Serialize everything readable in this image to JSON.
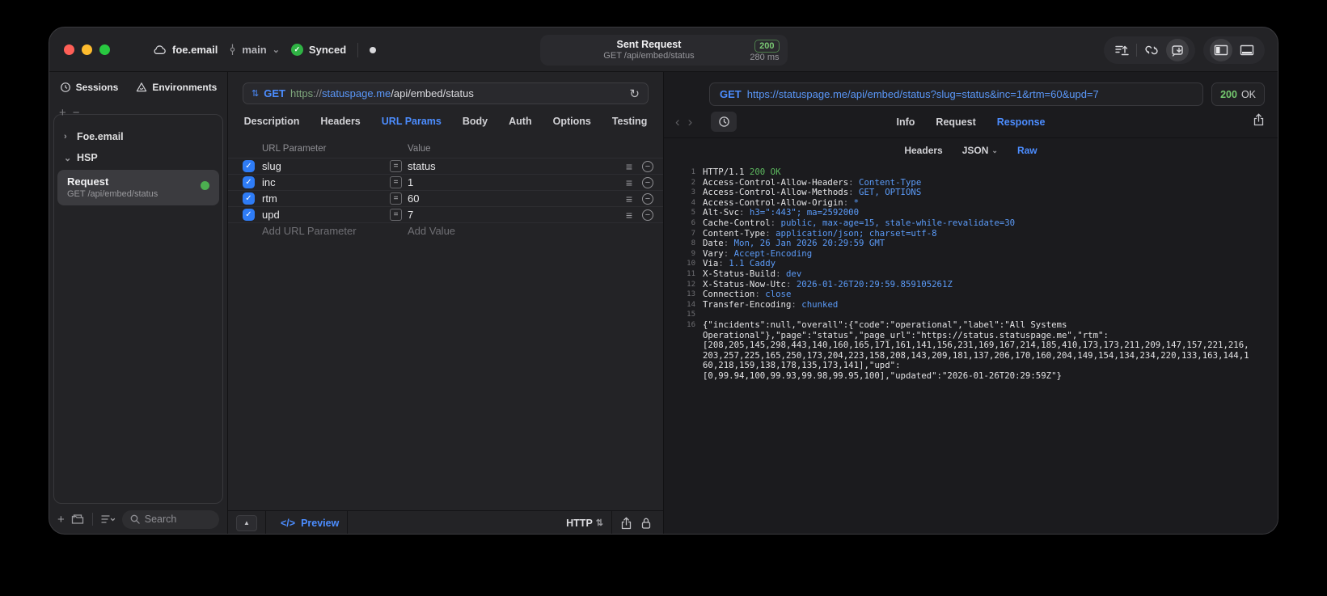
{
  "titlebar": {
    "project": "foe.email",
    "branch": "main",
    "sync_label": "Synced",
    "request_summary": {
      "title": "Sent Request",
      "subtitle": "GET /api/embed/status",
      "status_code": "200",
      "duration": "280 ms"
    }
  },
  "sidebar": {
    "tabs": [
      {
        "label": "Sessions"
      },
      {
        "label": "Environments"
      }
    ],
    "tree": [
      {
        "label": "Foe.email",
        "state": "collapsed"
      },
      {
        "label": "HSP",
        "state": "expanded"
      }
    ],
    "request_item": {
      "title": "Request",
      "subtitle": "GET /api/embed/status"
    },
    "search_placeholder": "Search"
  },
  "request_panel": {
    "method": "GET",
    "url": {
      "scheme": "https",
      "separator": "://",
      "host": "statuspage.me",
      "path": "/api/embed/status"
    },
    "tabs": [
      "Description",
      "Headers",
      "URL Params",
      "Body",
      "Auth",
      "Options",
      "Testing"
    ],
    "active_tab": "URL Params",
    "params": {
      "columns": [
        "URL Parameter",
        "Value"
      ],
      "rows": [
        {
          "name": "slug",
          "value": "status",
          "enabled": true
        },
        {
          "name": "inc",
          "value": "1",
          "enabled": true
        },
        {
          "name": "rtm",
          "value": "60",
          "enabled": true
        },
        {
          "name": "upd",
          "value": "7",
          "enabled": true
        }
      ],
      "add_name_placeholder": "Add URL Parameter",
      "add_value_placeholder": "Add Value"
    },
    "footer": {
      "preview_label": "Preview",
      "protocol": "HTTP"
    }
  },
  "response_panel": {
    "method": "GET",
    "url": "https://statuspage.me/api/embed/status?slug=status&inc=1&rtm=60&upd=7",
    "status_badge": {
      "code": "200",
      "text": "OK"
    },
    "tabs": [
      "Info",
      "Request",
      "Response"
    ],
    "active_tab": "Response",
    "subtabs": [
      {
        "label": "Headers"
      },
      {
        "label": "JSON",
        "dropdown": true
      },
      {
        "label": "Raw"
      }
    ],
    "active_subtab": "Raw",
    "raw": {
      "status_line": {
        "protocol": "HTTP/1.1",
        "status": "200 OK"
      },
      "headers": [
        {
          "key": "Access-Control-Allow-Headers",
          "value": "Content-Type"
        },
        {
          "key": "Access-Control-Allow-Methods",
          "value": "GET, OPTIONS"
        },
        {
          "key": "Access-Control-Allow-Origin",
          "value": "*"
        },
        {
          "key": "Alt-Svc",
          "value": "h3=\":443\"; ma=2592000"
        },
        {
          "key": "Cache-Control",
          "value": "public, max-age=15, stale-while-revalidate=30"
        },
        {
          "key": "Content-Type",
          "value": "application/json; charset=utf-8"
        },
        {
          "key": "Date",
          "value": "Mon, 26 Jan 2026 20:29:59 GMT"
        },
        {
          "key": "Vary",
          "value": "Accept-Encoding"
        },
        {
          "key": "Via",
          "value": "1.1 Caddy"
        },
        {
          "key": "X-Status-Build",
          "value": "dev"
        },
        {
          "key": "X-Status-Now-Utc",
          "value": "2026-01-26T20:29:59.859105261Z"
        },
        {
          "key": "Connection",
          "value": "close"
        },
        {
          "key": "Transfer-Encoding",
          "value": "chunked"
        }
      ],
      "body_lines": [
        "{\"incidents\":null,\"overall\":{\"code\":\"operational\",\"label\":\"All Systems",
        "Operational\"},\"page\":\"status\",\"page_url\":\"https://status.statuspage.me\",\"rtm\":",
        "[208,205,145,298,443,140,160,165,171,161,141,156,231,169,167,214,185,410,173,173,211,209,147,157,221,216,",
        "203,257,225,165,250,173,204,223,158,208,143,209,181,137,206,170,160,204,149,154,134,234,220,133,163,144,1",
        "60,218,159,138,178,135,173,141],\"upd\":",
        "[0,99.94,100,99.93,99.98,99.95,100],\"updated\":\"2026-01-26T20:29:59Z\"}"
      ]
    }
  },
  "colors": {
    "accent_blue": "#4c8dff",
    "status_green": "#5cb85f",
    "badge_green": "#74c96f",
    "checkbox_blue": "#2e7cf6",
    "synced_green": "#2fb344"
  }
}
